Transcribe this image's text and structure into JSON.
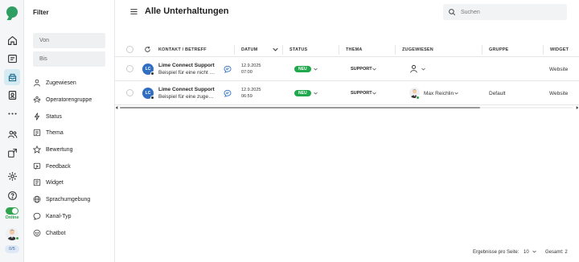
{
  "rail": {
    "online_label": "Online",
    "count_badge": "0/5",
    "icons": [
      "logo-icon",
      "home-icon",
      "inbox-icon",
      "conversations-icon",
      "contacts-icon",
      "more-icon",
      "team-icon",
      "integrations-icon",
      "settings-icon",
      "help-icon"
    ],
    "accent": "#2ea44f",
    "active_bg": "#d6eaf2"
  },
  "filter": {
    "title": "Filter",
    "from_placeholder": "Von",
    "to_placeholder": "Bis",
    "items": [
      {
        "label": "Zugewiesen",
        "icon": "person-icon"
      },
      {
        "label": "Operatorengruppe",
        "icon": "group-icon"
      },
      {
        "label": "Status",
        "icon": "bolt-icon"
      },
      {
        "label": "Thema",
        "icon": "topic-icon"
      },
      {
        "label": "Bewertung",
        "icon": "star-icon"
      },
      {
        "label": "Feedback",
        "icon": "feedback-icon"
      },
      {
        "label": "Widget",
        "icon": "widget-icon"
      },
      {
        "label": "Sprachumgebung",
        "icon": "globe-icon"
      },
      {
        "label": "Kanal-Typ",
        "icon": "channel-icon"
      },
      {
        "label": "Chatbot",
        "icon": "chatbot-icon"
      }
    ]
  },
  "header": {
    "title": "Alle Unterhaltungen",
    "search_placeholder": "Suchen"
  },
  "table": {
    "columns": {
      "contact": "KONTAKT / BETREFF",
      "date": "DATUM",
      "status": "STATUS",
      "topic": "THEMA",
      "assigned": "ZUGEWIESEN",
      "group": "GRUPPE",
      "widget": "WIDGET"
    },
    "rows": [
      {
        "initials": "LC",
        "name": "Lime Connect Support",
        "subject": "Beispiel für eine nicht z...",
        "date": "12.9.2025",
        "time": "07:00",
        "status": "NEU",
        "topic": "SUPPORT",
        "assignee": "",
        "group": "",
        "widget": "Website"
      },
      {
        "initials": "LC",
        "name": "Lime Connect Support",
        "subject": "Beispiel für eine zugewi...",
        "date": "12.9.2025",
        "time": "06:59",
        "status": "NEU",
        "topic": "SUPPORT",
        "assignee": "Max Reichlin",
        "group": "Default",
        "widget": "Website"
      }
    ],
    "status_color": "#1fa84c",
    "avatar_color": "#2f6ec0"
  },
  "footer": {
    "per_page_label": "Ergebnisse pro Seite:",
    "per_page_value": "10",
    "total": "Gesamt: 2"
  }
}
